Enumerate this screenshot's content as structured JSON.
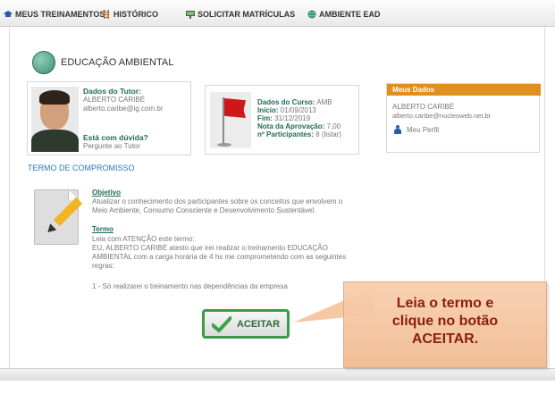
{
  "nav": {
    "items": [
      {
        "label": "MEUS TREINAMENTOS",
        "icon": "graduation-cap-icon"
      },
      {
        "label": "HISTÓRICO",
        "icon": "ladder-icon"
      },
      {
        "label": "SOLICITAR MATRÍCULAS",
        "icon": "classroom-icon"
      },
      {
        "label": "AMBIENTE EAD",
        "icon": "globe-icon"
      }
    ]
  },
  "course": {
    "title": "EDUCAÇÃO AMBIENTAL"
  },
  "tutor": {
    "heading": "Dados do Tutor:",
    "name": "ALBERTO CARIBÉ",
    "email": "alberto.caribe@ig.com.br",
    "doubt_heading": "Está com dúvida?",
    "doubt_link": "Pergunte ao Tutor"
  },
  "course_data": {
    "heading_label": "Dados do Curso:",
    "heading_value": "AMB",
    "start_label": "Início:",
    "start_value": "01/09/2013",
    "end_label": "Fim:",
    "end_value": "31/12/2019",
    "grade_label": "Nota da Aprovação:",
    "grade_value": "7,00",
    "participants_label": "nº Participantes:",
    "participants_value": "8 (listar)"
  },
  "user": {
    "heading": "Meus Dados",
    "name": "ALBERTO CARIBÉ",
    "email": "alberto.caribe@nucleoweb.net.br",
    "profile_link": "Meu Perfil"
  },
  "term": {
    "section_title": "TERMO DE COMPROMISSO",
    "objective_label": "Objetivo",
    "objective_line1": "Atualizar o conhecimento dos participantes sobre os conceitos que envolvem o",
    "objective_line2": "Meio Ambiente, Consumo Consciente e Desenvolvimento Sustentável.",
    "term_label": "Termo",
    "term_line1": "Leia com ATENÇÃO este termo:",
    "term_line2": "EU, ALBERTO CARIBÉ atesto que irei realizar o treinamento EDUCAÇÃO",
    "term_line3": "AMBIENTAL com a carga horária de 4 hs me comprometendo com as seguintes",
    "term_line4": "regras:",
    "rule1": "1 - Só realizarei o treinamento nas dependências da empresa"
  },
  "accept_button": {
    "label": "ACEITAR"
  },
  "callout": {
    "line1": "Leia o termo e",
    "line2": "clique no botão",
    "line3": "ACEITAR."
  },
  "colors": {
    "accent_green": "#1d6b59",
    "callout_bg": "#f5c39a",
    "callout_text": "#8a1f0c",
    "user_header": "#e0901c"
  }
}
